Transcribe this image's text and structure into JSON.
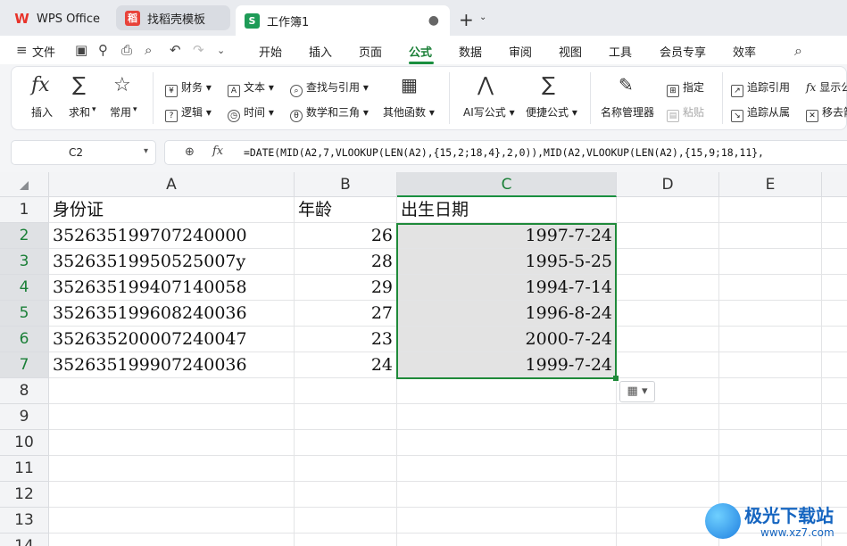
{
  "tabs": {
    "wps": "WPS Office",
    "template": "找稻壳模板",
    "workbook": "工作簿1",
    "workbook_dot": "●"
  },
  "menu": {
    "file": "文件",
    "tabs": [
      "开始",
      "插入",
      "页面",
      "公式",
      "数据",
      "审阅",
      "视图",
      "工具",
      "会员专享",
      "效率"
    ],
    "active_tab": "公式"
  },
  "ribbon": {
    "insert": "插入",
    "sum": "求和",
    "common": "常用",
    "finance": "财务",
    "text": "文本",
    "lookup": "查找与引用",
    "logic": "逻辑",
    "time": "时间",
    "math": "数学和三角",
    "other": "其他函数",
    "ai_formula": "AI写公式",
    "quick_formula": "便捷公式",
    "name_manager": "名称管理器",
    "specify": "指定",
    "paste": "粘贴",
    "trace_precedents": "追踪引用",
    "show_formula": "显示公",
    "trace_dependents": "追踪从属",
    "remove_arrows": "移去箭"
  },
  "formula_bar": {
    "cell_ref": "C2",
    "formula": "=DATE(MID(A2,7,VLOOKUP(LEN(A2),{15,2;18,4},2,0)),MID(A2,VLOOKUP(LEN(A2),{15,9;18,11},"
  },
  "sheet": {
    "columns": [
      "A",
      "B",
      "C",
      "D",
      "E"
    ],
    "rows": [
      "1",
      "2",
      "3",
      "4",
      "5",
      "6",
      "7",
      "8",
      "9",
      "10",
      "11",
      "12",
      "13",
      "14"
    ],
    "header": [
      "身份证",
      "年龄",
      "出生日期"
    ],
    "data": [
      [
        "352635199707240000",
        "26",
        "1997-7-24"
      ],
      [
        "35263519950525007y",
        "28",
        "1995-5-25"
      ],
      [
        "352635199407140058",
        "29",
        "1994-7-14"
      ],
      [
        "352635199608240036",
        "27",
        "1996-8-24"
      ],
      [
        "352635200007240047",
        "23",
        "2000-7-24"
      ],
      [
        "352635199907240036",
        "24",
        "1999-7-24"
      ]
    ],
    "selected_column": "C",
    "accent_color": "#1f8a3a"
  },
  "watermark": {
    "title": "极光下载站",
    "url": "www.xz7.com"
  }
}
